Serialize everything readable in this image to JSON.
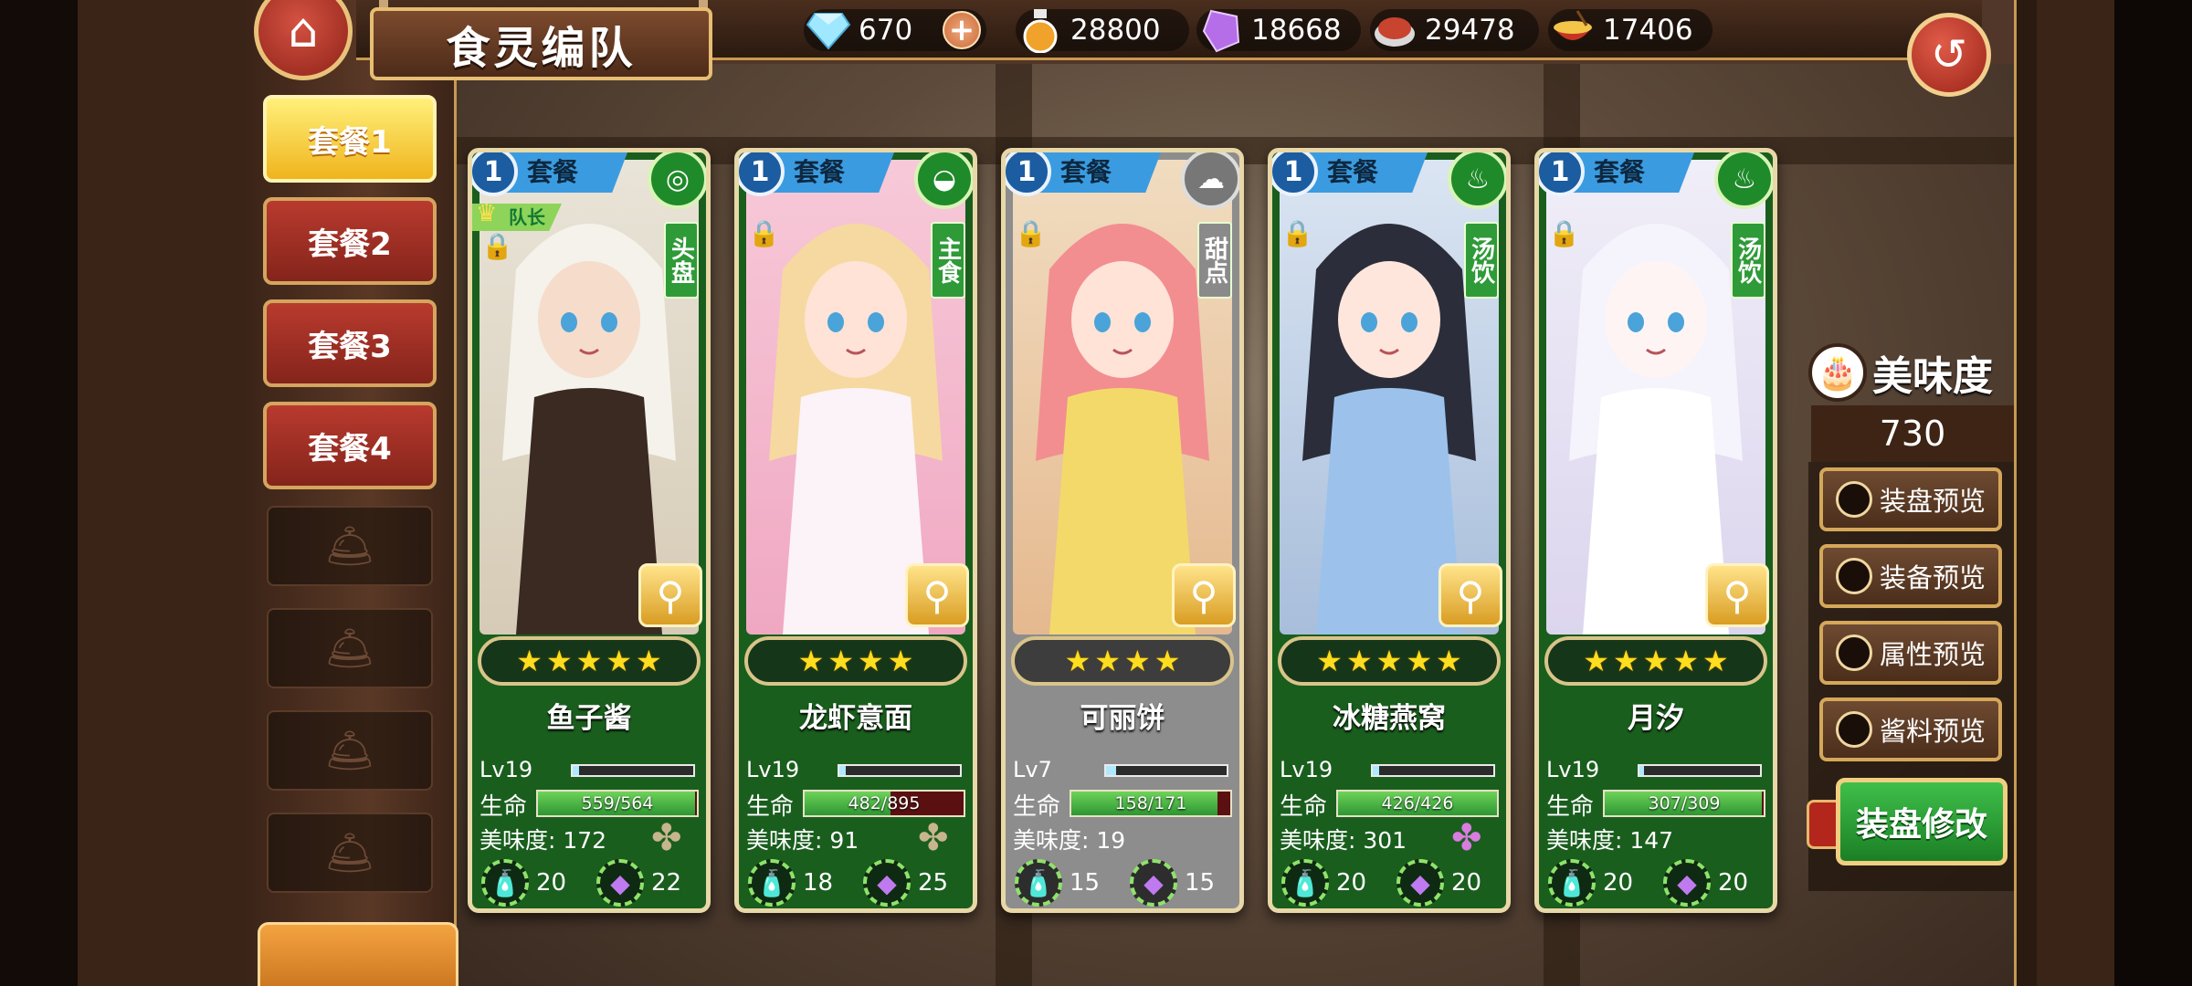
{
  "header": {
    "title": "食灵编队"
  },
  "resources": [
    {
      "icon": "diamond-icon",
      "value": "670"
    },
    {
      "icon": "bottle-icon",
      "value": "28800"
    },
    {
      "icon": "crystal-icon",
      "value": "18668"
    },
    {
      "icon": "meat-icon",
      "value": "29478"
    },
    {
      "icon": "bowl-icon",
      "value": "17406"
    }
  ],
  "sets": {
    "tabs": [
      "套餐1",
      "套餐2",
      "套餐3",
      "套餐4"
    ],
    "active": 0,
    "locked_slots": 4
  },
  "cards": [
    {
      "set_num": "1",
      "set_label": "套餐",
      "type": "头盘",
      "type_icon": "plate-icon",
      "leader": "队长",
      "name": "鱼子酱",
      "stars": 5,
      "level": "Lv19",
      "xp_fraction": 0.05,
      "hp_label": "生命",
      "hp": "559/564",
      "hp_fraction": 0.991,
      "taste_label": "美味度: 172",
      "cost_a": "20",
      "cost_b": "22",
      "grey": false,
      "clover": "clover-icon"
    },
    {
      "set_num": "1",
      "set_label": "套餐",
      "type": "主食",
      "type_icon": "rice-bowl-icon",
      "leader": "",
      "name": "龙虾意面",
      "stars": 4,
      "level": "Lv19",
      "xp_fraction": 0.05,
      "hp_label": "生命",
      "hp": "482/895",
      "hp_fraction": 0.539,
      "taste_label": "美味度: 91",
      "cost_a": "18",
      "cost_b": "25",
      "grey": false,
      "clover": "clover-icon"
    },
    {
      "set_num": "1",
      "set_label": "套餐",
      "type": "甜点",
      "type_icon": "cupcake-icon",
      "leader": "",
      "name": "可丽饼",
      "stars": 4,
      "level": "Lv7",
      "xp_fraction": 0.08,
      "hp_label": "生命",
      "hp": "158/171",
      "hp_fraction": 0.924,
      "taste_label": "美味度: 19",
      "cost_a": "15",
      "cost_b": "15",
      "grey": true,
      "clover": ""
    },
    {
      "set_num": "1",
      "set_label": "套餐",
      "type": "汤饮",
      "type_icon": "soup-icon",
      "leader": "",
      "name": "冰糖燕窝",
      "stars": 5,
      "level": "Lv19",
      "xp_fraction": 0.05,
      "hp_label": "生命",
      "hp": "426/426",
      "hp_fraction": 1.0,
      "taste_label": "美味度: 301",
      "cost_a": "20",
      "cost_b": "20",
      "grey": false,
      "clover": "clover-pink-icon"
    },
    {
      "set_num": "1",
      "set_label": "套餐",
      "type": "汤饮",
      "type_icon": "soup-icon",
      "leader": "",
      "name": "月汐",
      "stars": 5,
      "level": "Lv19",
      "xp_fraction": 0.04,
      "hp_label": "生命",
      "hp": "307/309",
      "hp_fraction": 0.994,
      "taste_label": "美味度: 147",
      "cost_a": "20",
      "cost_b": "20",
      "grey": false,
      "clover": ""
    }
  ],
  "panel": {
    "taste_title": "美味度",
    "taste_value": "730",
    "buttons": [
      "装盘预览",
      "装备预览",
      "属性预览",
      "酱料预览"
    ],
    "edit_label": "装盘修改"
  },
  "colors": {
    "accent_gold": "#d5a75a",
    "card_green": "#1a5e1e",
    "tab_red": "#b93a2e",
    "tab_active": "#f0b41d"
  }
}
